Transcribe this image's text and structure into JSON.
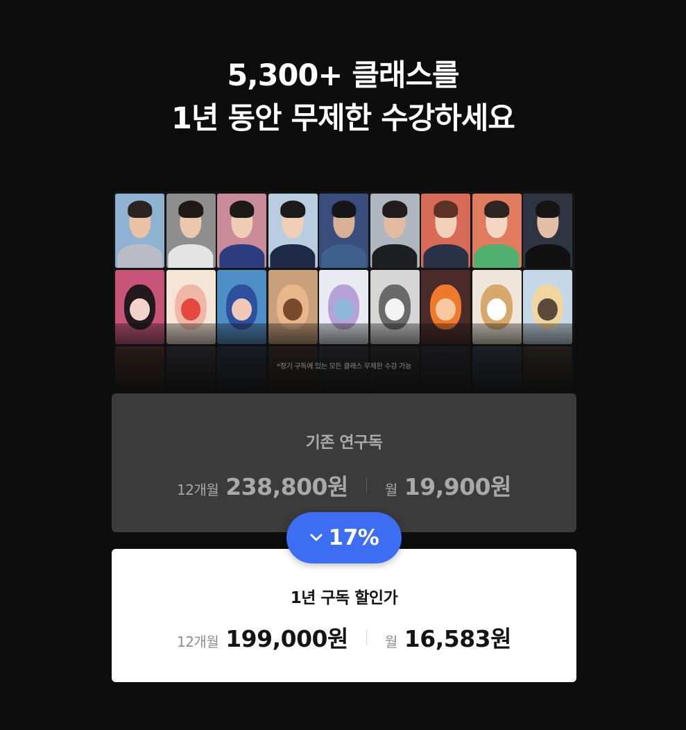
{
  "headline": {
    "line1": "5,300+ 클래스를",
    "line2": "1년 동안 무제한 수강하세요"
  },
  "gallery": {
    "note": "*정기 구독에 있는 모든 클래스 무제한 수강 가능",
    "row1": [
      {
        "icon": "instructor-portrait",
        "bg": "#8fb2d2",
        "skin": "#e9c2a5",
        "hair": "#2b2320",
        "cloth": "#b9bcc4"
      },
      {
        "icon": "instructor-portrait",
        "bg": "#8e8e8e",
        "skin": "#ebc7ad",
        "hair": "#1f1a17",
        "cloth": "#e4e4e4"
      },
      {
        "icon": "instructor-portrait",
        "bg": "#c98b9a",
        "skin": "#efcdb4",
        "hair": "#1d1a1a",
        "cloth": "#2c3e80"
      },
      {
        "icon": "instructor-portrait",
        "bg": "#b9cde0",
        "skin": "#f0cfb6",
        "hair": "#1c1a1a",
        "cloth": "#1f2b46"
      },
      {
        "icon": "instructor-portrait",
        "bg": "#3a4d7c",
        "skin": "#d8b096",
        "hair": "#161618",
        "cloth": "#3f5f8e"
      },
      {
        "icon": "instructor-portrait",
        "bg": "#aeb6bf",
        "skin": "#e3bba1",
        "hair": "#221d1c",
        "cloth": "#1e1f22"
      },
      {
        "icon": "instructor-portrait",
        "bg": "#d86a58",
        "skin": "#f2d0ba",
        "hair": "#5a3325",
        "cloth": "#2a3247"
      },
      {
        "icon": "instructor-portrait",
        "bg": "#e07c5d",
        "skin": "#f4d6c2",
        "hair": "#2e2421",
        "cloth": "#4fb06f"
      },
      {
        "icon": "instructor-portrait",
        "bg": "#2e3442",
        "skin": "#e2bea6",
        "hair": "#151515",
        "cloth": "#111111"
      }
    ],
    "row2": [
      {
        "icon": "artwork-dark-portrait",
        "bg": "#c8547a",
        "c1": "#231a1f",
        "c2": "#f1d3c8"
      },
      {
        "icon": "artwork-strawberry-face",
        "bg": "#f4e5d6",
        "c1": "#f1b7a6",
        "c2": "#e5493d"
      },
      {
        "icon": "artwork-blue-girl",
        "bg": "#4f8fc8",
        "c1": "#2f4f9f",
        "c2": "#f0c9b8"
      },
      {
        "icon": "artwork-warm-girl",
        "bg": "#c8a079",
        "c1": "#e9b58b",
        "c2": "#7a4a2c"
      },
      {
        "icon": "artwork-ice-girl",
        "bg": "#e8ecf2",
        "c1": "#b6a2d6",
        "c2": "#8fb7d9"
      },
      {
        "icon": "artwork-sketch-man",
        "bg": "#d6d6d6",
        "c1": "#6a6a6a",
        "c2": "#f4f4f4"
      },
      {
        "icon": "artwork-orange-character",
        "bg": "#4b2a2a",
        "c1": "#f07a2b",
        "c2": "#f9c7a0"
      },
      {
        "icon": "artwork-clip-studio-dog",
        "bg": "#efe6db",
        "c1": "#d8a86a",
        "c2": "#ffffff"
      },
      {
        "icon": "artwork-bear-character",
        "bg": "#c4d8e8",
        "c1": "#f1d59e",
        "c2": "#5b4a3a"
      }
    ],
    "row3": [
      {
        "icon": "artwork-faded",
        "bg": "#7a4438"
      },
      {
        "icon": "artwork-faded",
        "bg": "#4f4a56"
      },
      {
        "icon": "artwork-faded",
        "bg": "#3a4d66"
      },
      {
        "icon": "artwork-faded",
        "bg": "#5c4436"
      },
      {
        "icon": "artwork-faded",
        "bg": "#4a4a52"
      },
      {
        "icon": "artwork-faded",
        "bg": "#3c3c3c"
      },
      {
        "icon": "artwork-faded",
        "bg": "#3a3a44"
      },
      {
        "icon": "artwork-faded",
        "bg": "#465870"
      },
      {
        "icon": "artwork-faded",
        "bg": "#5a463d"
      }
    ]
  },
  "old_plan": {
    "title": "기존 연구독",
    "period_label": "12개월",
    "period_price": "238,800원",
    "monthly_label": "월",
    "monthly_price": "19,900원"
  },
  "discount": {
    "icon": "chevron-down-icon",
    "value": "17%",
    "color": "#3d6df2"
  },
  "new_plan": {
    "title": "1년 구독 할인가",
    "period_label": "12개월",
    "period_price": "199,000원",
    "monthly_label": "월",
    "monthly_price": "16,583원"
  }
}
